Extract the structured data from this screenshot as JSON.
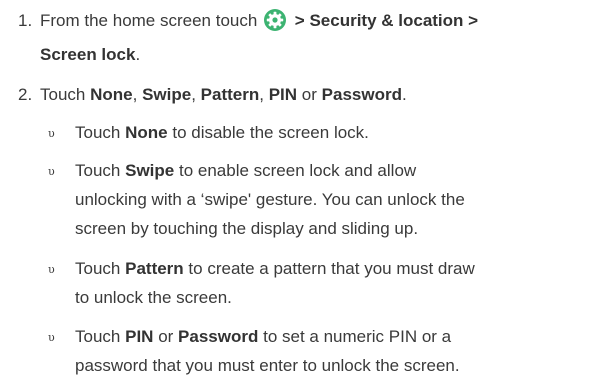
{
  "step1": {
    "number": "1.",
    "prefix": "From the home screen touch",
    "icon": "settings-gear-icon",
    "icon_color": "#3cb371",
    "path": "> Security & location >",
    "path_end": "Screen lock",
    "suffix": "."
  },
  "step2": {
    "number": "2.",
    "prefix": "Touch",
    "opt1": "None",
    "sep1": ",",
    "opt2": "Swipe",
    "sep2": ",",
    "opt3": "Pattern",
    "sep3": ",",
    "opt4": "PIN",
    "or": "or",
    "opt5": "Password",
    "end": "."
  },
  "bullets": {
    "mark": "υ",
    "b1": {
      "lead": "Touch",
      "bold": "None",
      "rest": "to disable the screen lock."
    },
    "b2": {
      "lead": "Touch",
      "bold": "Swipe",
      "rest_line1": "to enable screen lock and allow",
      "rest_line2": "unlocking with a ‘swipe' gesture. You can unlock the",
      "rest_line3": "screen by touching the display and sliding up."
    },
    "b3": {
      "lead": "Touch",
      "bold": "Pattern",
      "rest_line1": "to create a pattern that you must draw",
      "rest_line2": "to unlock the screen."
    },
    "b4": {
      "lead": "Touch",
      "bold1": "PIN",
      "or": "or",
      "bold2": "Password",
      "rest_line1": "to set a numeric PIN or a",
      "rest_line2": "password that you must enter to unlock the screen."
    }
  }
}
